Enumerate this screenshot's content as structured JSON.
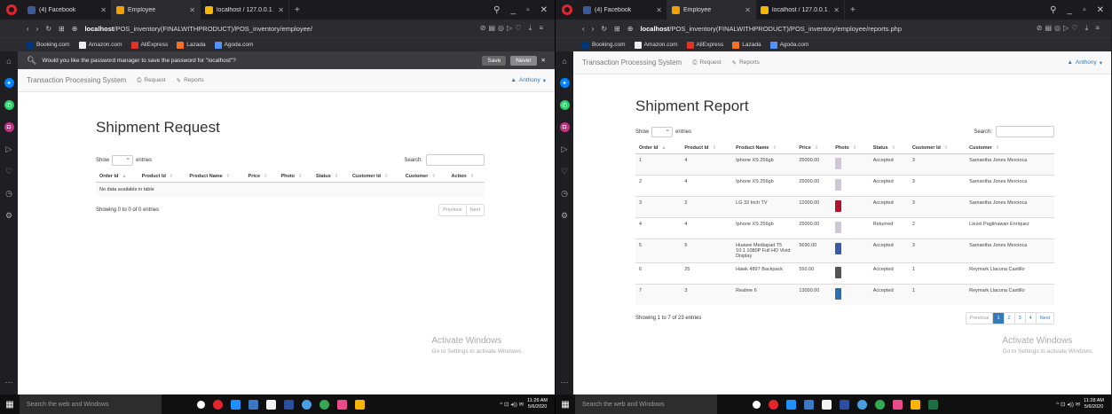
{
  "left": {
    "tabs": [
      {
        "title": "(4) Facebook",
        "favcolor": "#3b5998"
      },
      {
        "title": "Employee",
        "favcolor": "#f0a000"
      },
      {
        "title": "localhost / 127.0.0.1 / pos...",
        "favcolor": "#f7b500"
      }
    ],
    "url_host": "localhost",
    "url_path": "/POS_inventory(FINALWITHPRODUCT)/POS_inventory/employee/",
    "password_prompt": "Would you like the password manager to save the password for \"localhost\"?",
    "save_label": "Save",
    "never_label": "Never",
    "nav": {
      "brand": "Transaction Processing System",
      "request": "Request",
      "reports": "Reports",
      "user": "Anthony"
    },
    "title": "Shipment Request",
    "show_label": "Show",
    "entries_label": "entries",
    "search_label": "Search:",
    "columns": [
      "Order Id",
      "Product Id",
      "Product Name",
      "Price",
      "Photo",
      "Status",
      "Customer Id",
      "Customer",
      "Action"
    ],
    "empty_text": "No data available in table",
    "info": "Showing 0 to 0 of 0 entries",
    "prev": "Previous",
    "next": "Next",
    "clock_time": "11:26 AM",
    "clock_date": "5/6/2020"
  },
  "right": {
    "tabs": [
      {
        "title": "(4) Facebook",
        "favcolor": "#3b5998"
      },
      {
        "title": "Employee",
        "favcolor": "#f0a000"
      },
      {
        "title": "localhost / 127.0.0.1 / pos...",
        "favcolor": "#f7b500"
      }
    ],
    "url_host": "localhost",
    "url_path": "/POS_inventory(FINALWITHPRODUCT)/POS_inventory/employee/reports.php",
    "nav": {
      "brand": "Transaction Processing System",
      "request": "Request",
      "reports": "Reports",
      "user": "Anthony"
    },
    "title": "Shipment Report",
    "show_label": "Show",
    "entries_label": "entries",
    "search_label": "Search:",
    "columns": [
      "Order Id",
      "Product Id",
      "Product Name",
      "Price",
      "Photo",
      "Status",
      "Customer Id",
      "Customer"
    ],
    "rows": [
      {
        "order": "1",
        "product": "4",
        "name": "Iphone XS 256gb",
        "price": "25000.00",
        "photo_color": "#cfc6d6",
        "status": "Accepted",
        "cust_id": "3",
        "customer": "Samantha Jones Mercioca"
      },
      {
        "order": "2",
        "product": "4",
        "name": "Iphone XS 256gb",
        "price": "25000.00",
        "photo_color": "#cfc6d6",
        "status": "Accepted",
        "cust_id": "3",
        "customer": "Samantha Jones Mercioca"
      },
      {
        "order": "3",
        "product": "2",
        "name": "LG 32 Inch TV",
        "price": "12000.00",
        "photo_color": "#b3122d",
        "status": "Accepted",
        "cust_id": "3",
        "customer": "Samantha Jones Mercioca"
      },
      {
        "order": "4",
        "product": "4",
        "name": "Iphone XS 256gb",
        "price": "25000.00",
        "photo_color": "#cfc6d6",
        "status": "Returned",
        "cust_id": "2",
        "customer": "Liezel Paglinawan Enriquez"
      },
      {
        "order": "5",
        "product": "5",
        "name": "Huawei Mediapad T5 10.1 1080P Full HD Vivid Display",
        "price": "5690.00",
        "photo_color": "#3a5ba8",
        "status": "Accepted",
        "cust_id": "3",
        "customer": "Samantha Jones Mercioca"
      },
      {
        "order": "6",
        "product": "25",
        "name": "Hawk 4897 Backpack",
        "price": "550.00",
        "photo_color": "#555555",
        "status": "Accepted",
        "cust_id": "1",
        "customer": "Reymark Llacuna Castillo"
      },
      {
        "order": "7",
        "product": "3",
        "name": "Realme 6",
        "price": "13000.00",
        "photo_color": "#2a6fb0",
        "status": "Accepted",
        "cust_id": "1",
        "customer": "Reymark Llacuna Castillo"
      }
    ],
    "info": "Showing 1 to 7 of 23 entries",
    "prev": "Previous",
    "pages": [
      "1",
      "2",
      "3",
      "4"
    ],
    "next": "Next",
    "clock_time": "11:28 AM",
    "clock_date": "5/6/2020"
  },
  "bookmarks": [
    "Booking.com",
    "Amazon.com",
    "AliExpress",
    "Lazada",
    "Agoda.com"
  ],
  "watermark": {
    "title": "Activate Windows",
    "sub": "Go to Settings to activate Windows."
  },
  "taskbar_search": "Search the web and Windows"
}
